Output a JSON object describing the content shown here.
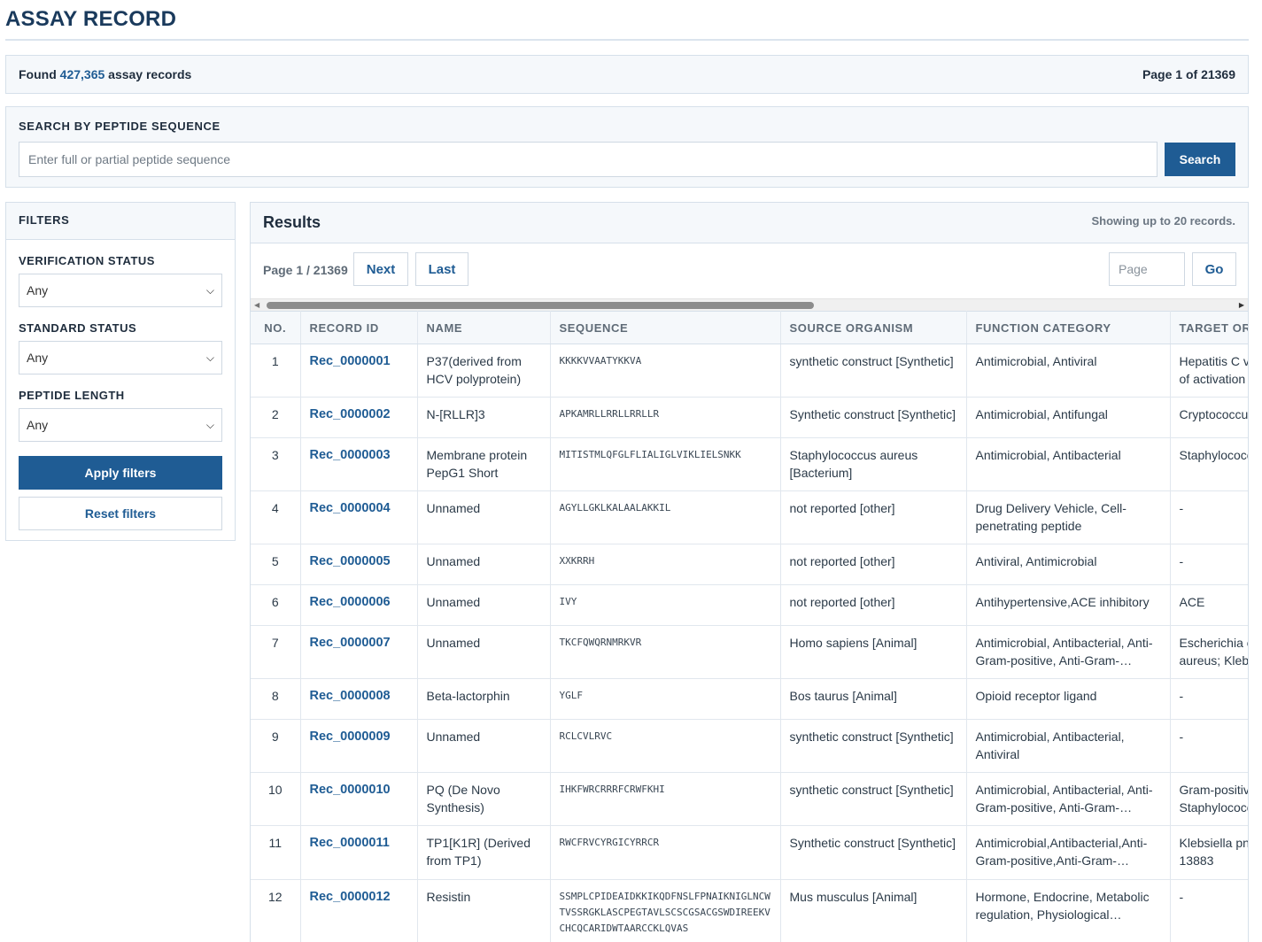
{
  "page": {
    "title": "ASSAY RECORD"
  },
  "summary": {
    "found_prefix": "Found",
    "count": "427,365",
    "found_suffix": "assay records",
    "page_info": "Page 1 of 21369"
  },
  "search": {
    "label": "SEARCH BY PEPTIDE SEQUENCE",
    "placeholder": "Enter full or partial peptide sequence",
    "button": "Search"
  },
  "filters": {
    "title": "FILTERS",
    "groups": [
      {
        "label": "VERIFICATION STATUS",
        "value": "Any"
      },
      {
        "label": "STANDARD STATUS",
        "value": "Any"
      },
      {
        "label": "PEPTIDE LENGTH",
        "value": "Any"
      }
    ],
    "apply": "Apply filters",
    "reset": "Reset filters"
  },
  "results": {
    "title": "Results",
    "note": "Showing up to 20 records.",
    "pager_label": "Page 1 / 21369",
    "next": "Next",
    "last": "Last",
    "page_placeholder": "Page",
    "go": "Go",
    "columns": [
      "NO.",
      "RECORD ID",
      "NAME",
      "SEQUENCE",
      "SOURCE ORGANISM",
      "FUNCTION CATEGORY",
      "TARGET OR"
    ],
    "rows": [
      {
        "no": "1",
        "id": "Rec_0000001",
        "name": "P37(derived from HCV polyprotein)",
        "seq": "KKKKVVAATYKKVA",
        "org": "synthetic construct [Synthetic]",
        "func": "Antimicrobial, Antiviral",
        "target1": "Hepatitis C v",
        "target2": "of activation"
      },
      {
        "no": "2",
        "id": "Rec_0000002",
        "name": "N-[RLLR]3",
        "seq": "APKAMRLLRRLLRRLLR",
        "org": "Synthetic construct [Synthetic]",
        "func": "Antimicrobial, Antifungal",
        "target1": "Cryptococcus",
        "target2": ""
      },
      {
        "no": "3",
        "id": "Rec_0000003",
        "name": "Membrane protein PepG1 Short",
        "seq": "MITISTMLQFGLFLIALIGLVIKLIELSNKK",
        "org": "Staphylococcus aureus [Bacterium]",
        "func": "Antimicrobial, Antibacterial",
        "target1": "Staphylococc",
        "target2": ""
      },
      {
        "no": "4",
        "id": "Rec_0000004",
        "name": "Unnamed",
        "seq": "AGYLLGKLKALAALAKKIL",
        "org": "not reported [other]",
        "func": "Drug Delivery Vehicle, Cell-penetrating peptide",
        "target1": "-",
        "target2": ""
      },
      {
        "no": "5",
        "id": "Rec_0000005",
        "name": "Unnamed",
        "seq": "XXKRRH",
        "org": "not reported [other]",
        "func": "Antiviral, Antimicrobial",
        "target1": "-",
        "target2": ""
      },
      {
        "no": "6",
        "id": "Rec_0000006",
        "name": "Unnamed",
        "seq": "IVY",
        "org": "not reported [other]",
        "func": "Antihypertensive,ACE inhibitory",
        "target1": "ACE",
        "target2": ""
      },
      {
        "no": "7",
        "id": "Rec_0000007",
        "name": "Unnamed",
        "seq": "TKCFQWQRNMRKVR",
        "org": "Homo sapiens [Animal]",
        "func": "Antimicrobial, Antibacterial, Anti-Gram-positive, Anti-Gram-…",
        "target1": "Escherichia c",
        "target2": "aureus; Kleb"
      },
      {
        "no": "8",
        "id": "Rec_0000008",
        "name": "Beta-lactorphin",
        "seq": "YGLF",
        "org": "Bos taurus [Animal]",
        "func": "Opioid receptor ligand",
        "target1": "-",
        "target2": ""
      },
      {
        "no": "9",
        "id": "Rec_0000009",
        "name": "Unnamed",
        "seq": "RCLCVLRVC",
        "org": "synthetic construct [Synthetic]",
        "func": "Antimicrobial, Antibacterial, Antiviral",
        "target1": "-",
        "target2": ""
      },
      {
        "no": "10",
        "id": "Rec_0000010",
        "name": "PQ (De Novo Synthesis)",
        "seq": "IHKFWRCRRRFCRWFKHI",
        "org": "synthetic construct [Synthetic]",
        "func": "Antimicrobial, Antibacterial, Anti-Gram-positive, Anti-Gram-…",
        "target1": "Gram-positiv",
        "target2": "Staphylococc"
      },
      {
        "no": "11",
        "id": "Rec_0000011",
        "name": "TP1[K1R] (Derived from TP1)",
        "seq": "RWCFRVCYRGICYRRCR",
        "org": "Synthetic construct [Synthetic]",
        "func": "Antimicrobial,Antibacterial,Anti-Gram-positive,Anti-Gram-…",
        "target1": "Klebsiella pn",
        "target2": "13883"
      },
      {
        "no": "12",
        "id": "Rec_0000012",
        "name": "Resistin",
        "seq": "SSMPLCPIDEAIDKKIKQDFNSLFPNAIKNIGLNCWTVSSRGKLASCPEGTAVLSCSCGSACGSWDIREEKVCHCQCARIDWTAARCCKLQVAS",
        "org": "Mus musculus [Animal]",
        "func": "Hormone, Endocrine, Metabolic regulation, Physiological…",
        "target1": "-",
        "target2": ""
      }
    ]
  }
}
